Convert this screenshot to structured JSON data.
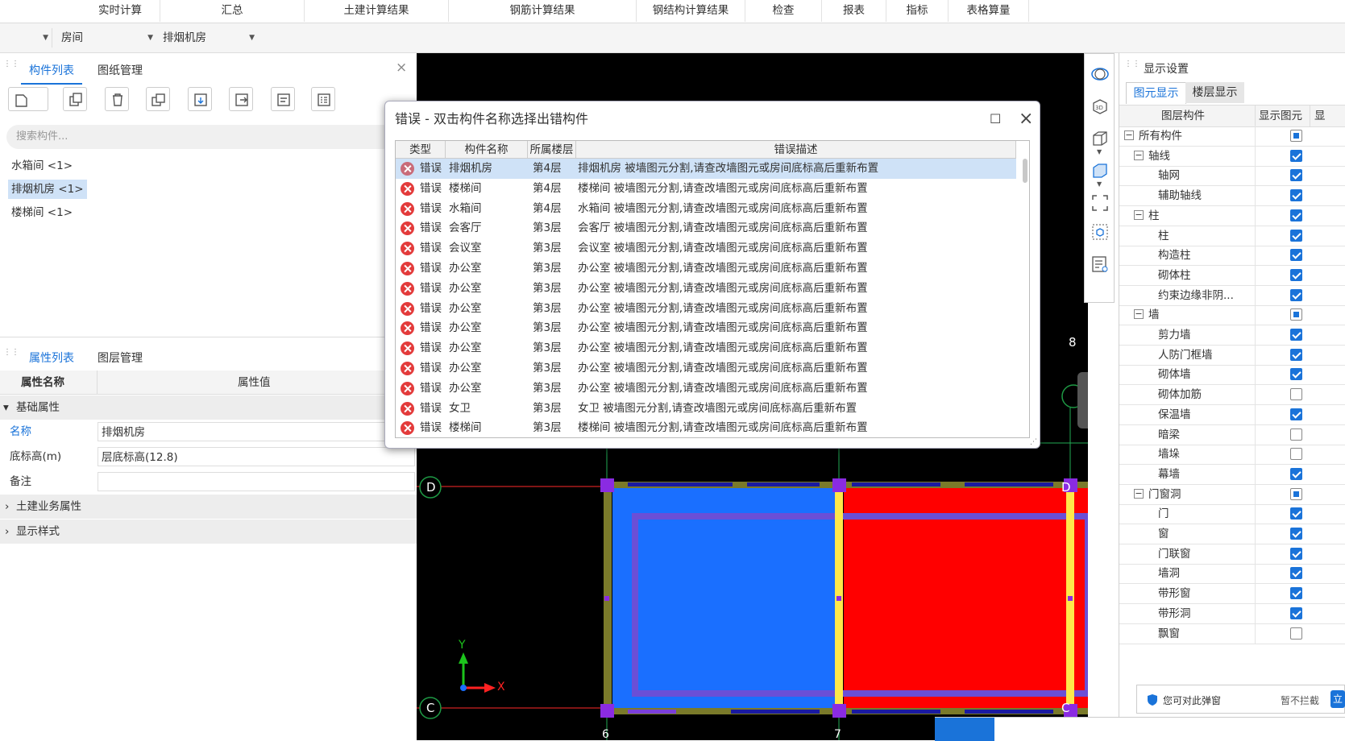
{
  "menu": [
    "实时计算",
    "汇总",
    "土建计算结果",
    "钢筋计算结果",
    "钢结构计算结果",
    "检查",
    "报表",
    "指标",
    "表格算量"
  ],
  "filters": {
    "type_select": "房间",
    "item_select": "排烟机房"
  },
  "left": {
    "tabs": [
      "构件列表",
      "图纸管理"
    ],
    "search_placeholder": "搜索构件...",
    "components": [
      "水箱间 <1>",
      "排烟机房 <1>",
      "楼梯间 <1>"
    ],
    "prop_tabs": [
      "属性列表",
      "图层管理"
    ],
    "prop_header": {
      "name": "属性名称",
      "value": "属性值"
    },
    "prop_group_basic": "基础属性",
    "props": [
      {
        "name": "名称",
        "value": "排烟机房"
      },
      {
        "name": "底标高(m)",
        "value": "层底标高(12.8)"
      },
      {
        "name": "备注",
        "value": ""
      }
    ],
    "prop_groups": [
      "土建业务属性",
      "显示样式"
    ]
  },
  "dialog": {
    "title": "错误 - 双击构件名称选择出错构件",
    "columns": [
      "类型",
      "构件名称",
      "所属楼层",
      "错误描述"
    ],
    "rows": [
      {
        "type": "错误",
        "name": "排烟机房",
        "floor": "第4层",
        "desc": "排烟机房 被墙图元分割,请查改墙图元或房间底标高后重新布置"
      },
      {
        "type": "错误",
        "name": "楼梯间",
        "floor": "第4层",
        "desc": "楼梯间 被墙图元分割,请查改墙图元或房间底标高后重新布置"
      },
      {
        "type": "错误",
        "name": "水箱间",
        "floor": "第4层",
        "desc": "水箱间 被墙图元分割,请查改墙图元或房间底标高后重新布置"
      },
      {
        "type": "错误",
        "name": "会客厅",
        "floor": "第3层",
        "desc": "会客厅 被墙图元分割,请查改墙图元或房间底标高后重新布置"
      },
      {
        "type": "错误",
        "name": "会议室",
        "floor": "第3层",
        "desc": "会议室 被墙图元分割,请查改墙图元或房间底标高后重新布置"
      },
      {
        "type": "错误",
        "name": "办公室",
        "floor": "第3层",
        "desc": "办公室 被墙图元分割,请查改墙图元或房间底标高后重新布置"
      },
      {
        "type": "错误",
        "name": "办公室",
        "floor": "第3层",
        "desc": "办公室 被墙图元分割,请查改墙图元或房间底标高后重新布置"
      },
      {
        "type": "错误",
        "name": "办公室",
        "floor": "第3层",
        "desc": "办公室 被墙图元分割,请查改墙图元或房间底标高后重新布置"
      },
      {
        "type": "错误",
        "name": "办公室",
        "floor": "第3层",
        "desc": "办公室 被墙图元分割,请查改墙图元或房间底标高后重新布置"
      },
      {
        "type": "错误",
        "name": "办公室",
        "floor": "第3层",
        "desc": "办公室 被墙图元分割,请查改墙图元或房间底标高后重新布置"
      },
      {
        "type": "错误",
        "name": "办公室",
        "floor": "第3层",
        "desc": "办公室 被墙图元分割,请查改墙图元或房间底标高后重新布置"
      },
      {
        "type": "错误",
        "name": "办公室",
        "floor": "第3层",
        "desc": "办公室 被墙图元分割,请查改墙图元或房间底标高后重新布置"
      },
      {
        "type": "错误",
        "name": "女卫",
        "floor": "第3层",
        "desc": "女卫 被墙图元分割,请查改墙图元或房间底标高后重新布置"
      },
      {
        "type": "错误",
        "name": "楼梯间",
        "floor": "第3层",
        "desc": "楼梯间 被墙图元分割,请查改墙图元或房间底标高后重新布置"
      }
    ]
  },
  "canvas": {
    "axis_labels": [
      "8",
      "D",
      "D",
      "C",
      "C",
      "6",
      "7"
    ],
    "axis_x": "X",
    "axis_y": "Y"
  },
  "display": {
    "title": "显示设置",
    "tabs": [
      "图元显示",
      "楼层显示"
    ],
    "headers": [
      "图层构件",
      "显示图元",
      "显"
    ],
    "rows": [
      {
        "label": "所有构件",
        "level": 0,
        "expander": "-",
        "state": "partial"
      },
      {
        "label": "轴线",
        "level": 1,
        "expander": "-",
        "state": "on"
      },
      {
        "label": "轴网",
        "level": 2,
        "expander": "",
        "state": "on"
      },
      {
        "label": "辅助轴线",
        "level": 2,
        "expander": "",
        "state": "on"
      },
      {
        "label": "柱",
        "level": 1,
        "expander": "-",
        "state": "on"
      },
      {
        "label": "柱",
        "level": 2,
        "expander": "",
        "state": "on"
      },
      {
        "label": "构造柱",
        "level": 2,
        "expander": "",
        "state": "on"
      },
      {
        "label": "砌体柱",
        "level": 2,
        "expander": "",
        "state": "on"
      },
      {
        "label": "约束边缘非阴...",
        "level": 2,
        "expander": "",
        "state": "on"
      },
      {
        "label": "墙",
        "level": 1,
        "expander": "-",
        "state": "partial"
      },
      {
        "label": "剪力墙",
        "level": 2,
        "expander": "",
        "state": "on"
      },
      {
        "label": "人防门框墙",
        "level": 2,
        "expander": "",
        "state": "on"
      },
      {
        "label": "砌体墙",
        "level": 2,
        "expander": "",
        "state": "on"
      },
      {
        "label": "砌体加筋",
        "level": 2,
        "expander": "",
        "state": "off"
      },
      {
        "label": "保温墙",
        "level": 2,
        "expander": "",
        "state": "on"
      },
      {
        "label": "暗梁",
        "level": 2,
        "expander": "",
        "state": "off"
      },
      {
        "label": "墙垛",
        "level": 2,
        "expander": "",
        "state": "off"
      },
      {
        "label": "幕墙",
        "level": 2,
        "expander": "",
        "state": "on"
      },
      {
        "label": "门窗洞",
        "level": 1,
        "expander": "-",
        "state": "partial"
      },
      {
        "label": "门",
        "level": 2,
        "expander": "",
        "state": "on"
      },
      {
        "label": "窗",
        "level": 2,
        "expander": "",
        "state": "on"
      },
      {
        "label": "门联窗",
        "level": 2,
        "expander": "",
        "state": "on"
      },
      {
        "label": "墙洞",
        "level": 2,
        "expander": "",
        "state": "on"
      },
      {
        "label": "带形窗",
        "level": 2,
        "expander": "",
        "state": "on"
      },
      {
        "label": "带形洞",
        "level": 2,
        "expander": "",
        "state": "on"
      },
      {
        "label": "飘窗",
        "level": 2,
        "expander": "",
        "state": "off"
      }
    ]
  },
  "popup": {
    "text": "您可对此弹窗",
    "action": "暂不拦截",
    "button": "立"
  },
  "colors": {
    "accent": "#1a73d9",
    "room_red": "#ff0000",
    "room_blue": "#1a6fff",
    "error": "#e33b3b"
  }
}
